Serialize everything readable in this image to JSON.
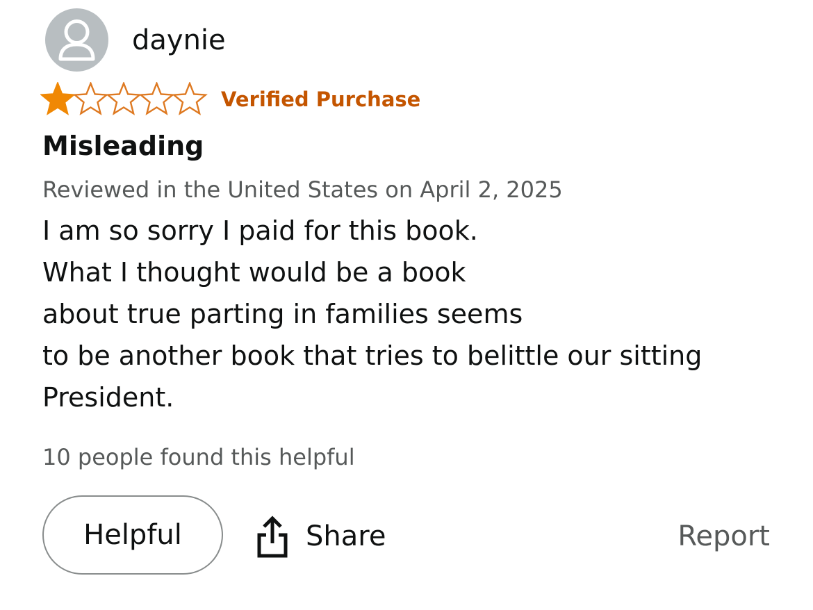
{
  "review": {
    "username": "daynie",
    "avatar_icon": "person-silhouette-icon",
    "rating": 1,
    "rating_max": 5,
    "star_filled_color": "#f08804",
    "star_empty_color": "#de7921",
    "verified_label": "Verified Purchase",
    "verified_color": "#c45500",
    "title": "Misleading",
    "meta": "Reviewed in the United States on April 2, 2025",
    "body_lines": [
      "I am so sorry I paid for this book.",
      "What I thought would be a book",
      "about true parting in families seems",
      "to be another book that tries to belittle our sitting",
      "President."
    ],
    "helpful_count_text": "10 people found this helpful"
  },
  "actions": {
    "helpful_label": "Helpful",
    "share_label": "Share",
    "share_icon": "share-upload-icon",
    "report_label": "Report"
  }
}
